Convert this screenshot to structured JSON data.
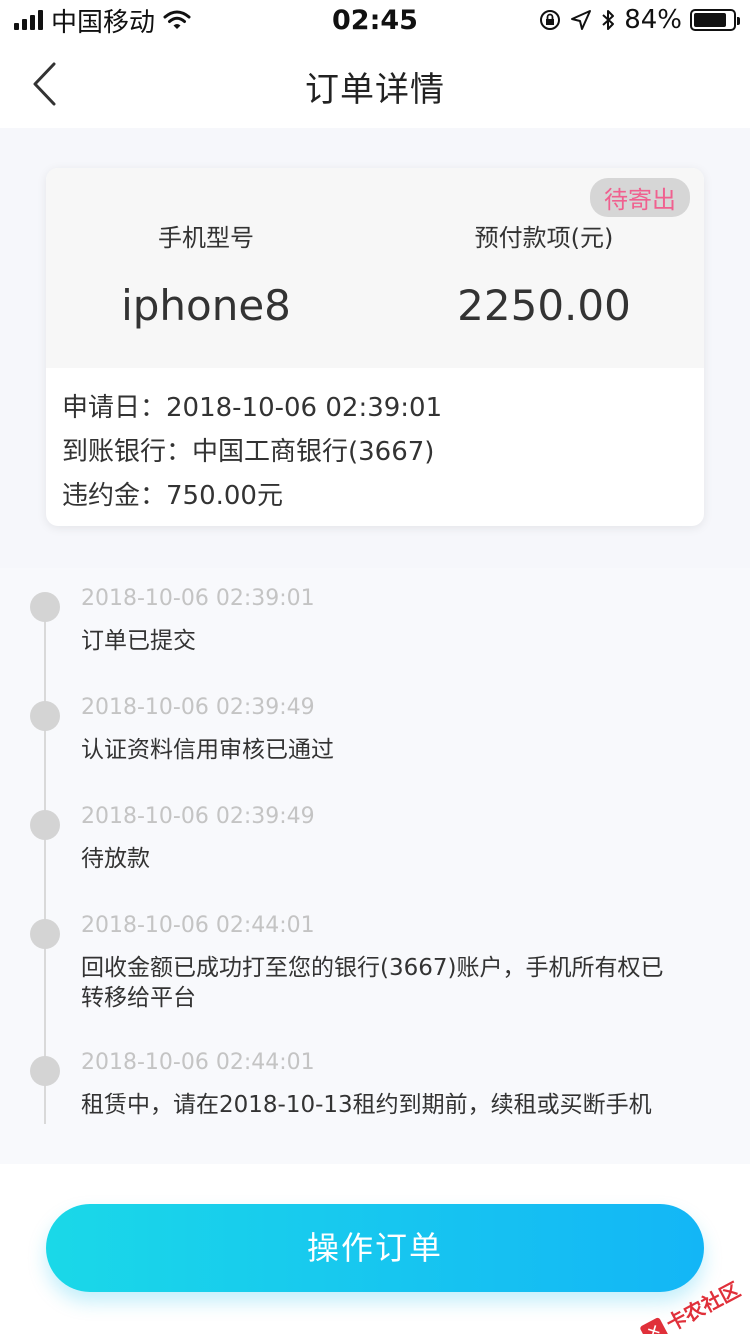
{
  "status_bar": {
    "carrier": "中国移动",
    "time": "02:45",
    "battery": "84%",
    "battery_level": 0.84
  },
  "nav": {
    "title": "订单详情"
  },
  "card": {
    "badge": "待寄出",
    "model_label": "手机型号",
    "model_value": "iphone8",
    "prepay_label": "预付款项(元)",
    "prepay_value": "2250.00",
    "apply_date": "申请日：2018-10-06 02:39:01",
    "bank": "到账银行：中国工商银行(3667)",
    "penalty": "违约金：750.00元"
  },
  "timeline": [
    {
      "time": "2018-10-06 02:39:01",
      "text": "订单已提交"
    },
    {
      "time": "2018-10-06 02:39:49",
      "text": "认证资料信用审核已通过"
    },
    {
      "time": "2018-10-06 02:39:49",
      "text": "待放款"
    },
    {
      "time": "2018-10-06 02:44:01",
      "text": "回收金额已成功打至您的银行(3667)账户，手机所有权已转移给平台"
    },
    {
      "time": "2018-10-06 02:44:01",
      "text": "租赁中，请在2018-10-13租约到期前，续租或买断手机"
    }
  ],
  "action": {
    "label": "操作订单"
  },
  "watermark": {
    "text": "卡农社区"
  },
  "colors": {
    "badge_text": "#f0608f",
    "button_start": "#1ad8e8",
    "button_end": "#13b6f6"
  },
  "icons": [
    "signal-icon",
    "wifi-icon",
    "orientation-lock-icon",
    "location-arrow-icon",
    "bluetooth-icon",
    "battery-icon",
    "back-chevron-icon"
  ]
}
